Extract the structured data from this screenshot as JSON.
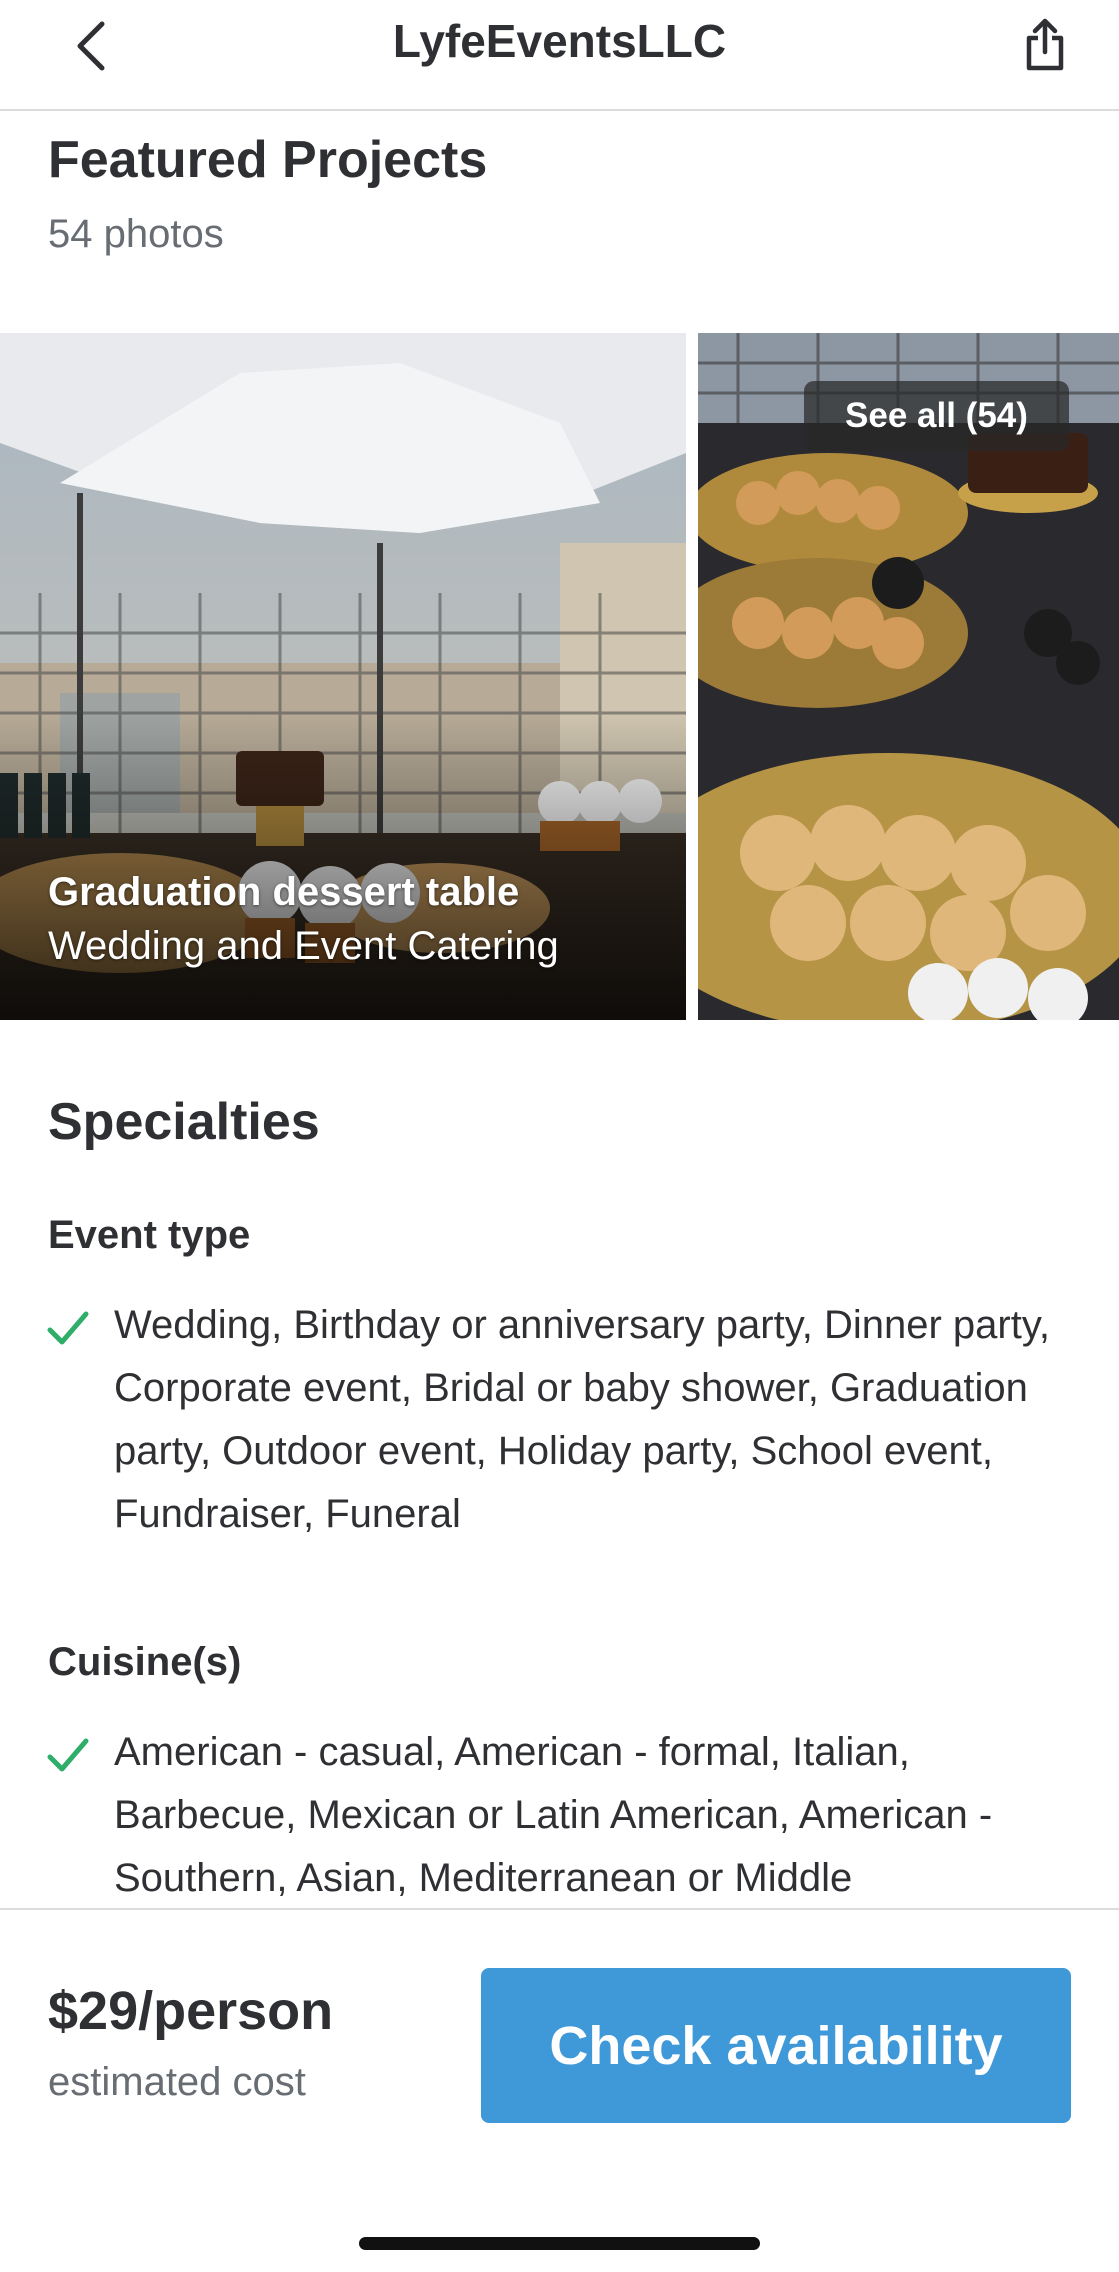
{
  "header": {
    "title": "LyfeEventsLLC",
    "back_icon": "chevron-left-icon",
    "share_icon": "share-icon"
  },
  "featured": {
    "title": "Featured Projects",
    "count_label": "54 photos",
    "main_photo": {
      "title": "Graduation dessert table",
      "subtitle": "Wedding and Event Catering"
    },
    "see_all_label": "See all (54)"
  },
  "specialties": {
    "title": "Specialties",
    "event_type": {
      "heading": "Event type",
      "text": "Wedding, Birthday or anniversary party, Dinner party, Corporate event, Bridal or baby shower, Graduation party, Outdoor event, Holiday party, School event, Fundraiser, Funeral"
    },
    "cuisines": {
      "heading": "Cuisine(s)",
      "text": "American - casual, American - formal, Italian, Barbecue, Mexican or Latin American, American - Southern, Asian, Mediterranean or Middle"
    }
  },
  "footer": {
    "price": "$29/person",
    "price_note": "estimated cost",
    "cta_label": "Check availability"
  },
  "colors": {
    "accent": "#3f98d8",
    "check": "#2fae6a",
    "text": "#2f3033",
    "muted": "#676d73"
  }
}
